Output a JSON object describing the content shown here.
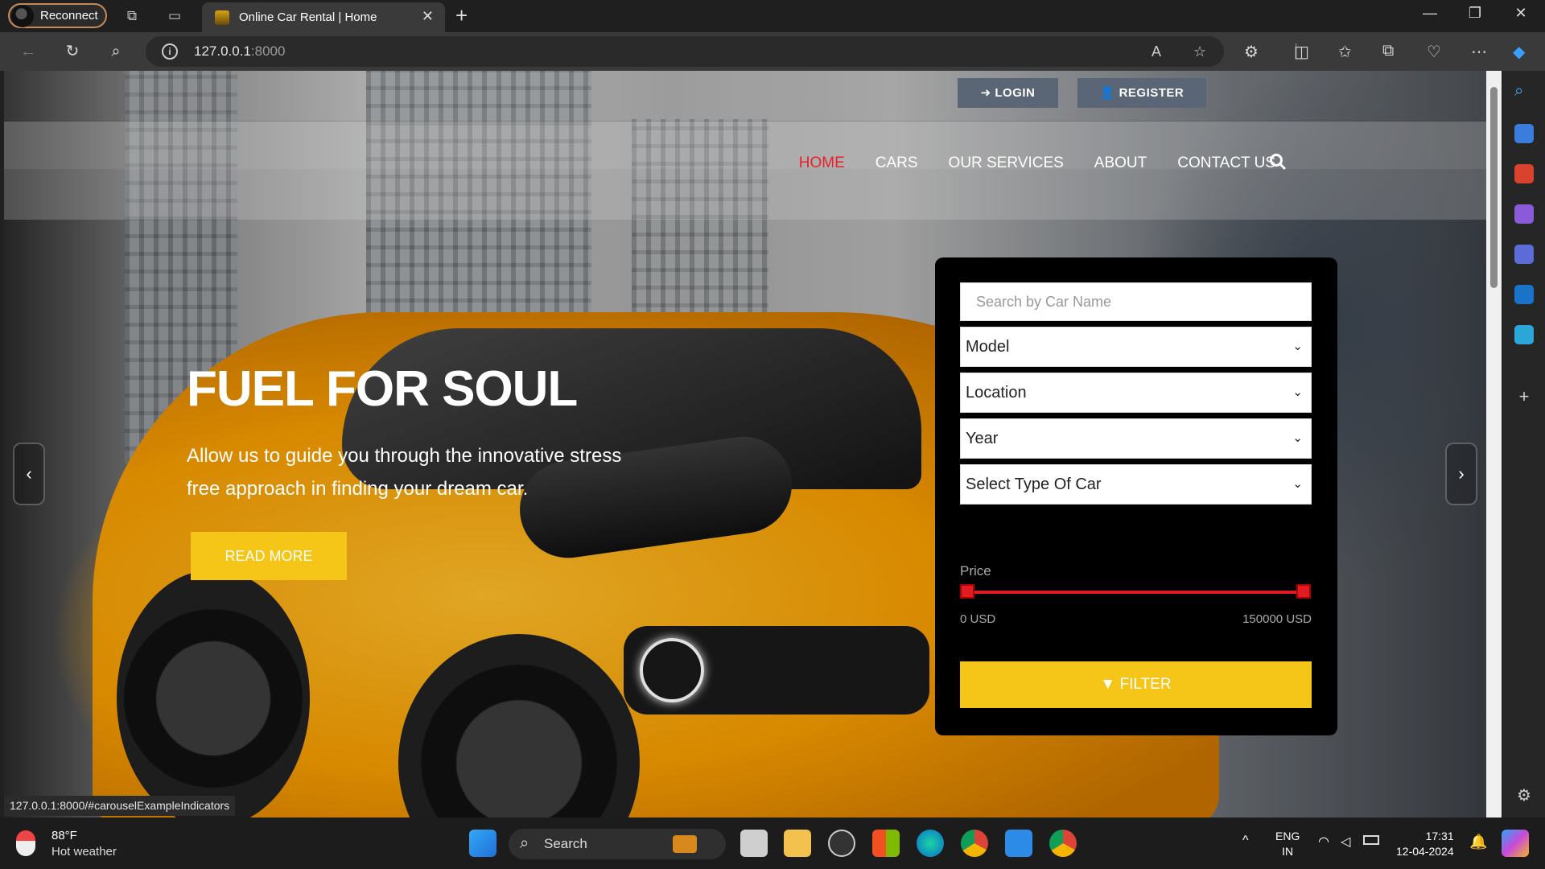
{
  "browser": {
    "reconnect_label": "Reconnect",
    "tab_title": "Online Car Rental | Home",
    "url_host": "127.0.0.1",
    "url_port": ":8000",
    "status_url": "127.0.0.1:8000/#carouselExampleIndicators"
  },
  "header": {
    "login_label": "LOGIN",
    "register_label": "REGISTER",
    "nav": [
      {
        "label": "HOME",
        "active": true
      },
      {
        "label": "CARS",
        "active": false
      },
      {
        "label": "OUR SERVICES",
        "active": false
      },
      {
        "label": "ABOUT",
        "active": false
      },
      {
        "label": "CONTACT US",
        "active": false
      }
    ]
  },
  "hero": {
    "title": "FUEL FOR SOUL",
    "subtitle": "Allow us to guide you through the innovative stress free approach in finding your dream car.",
    "cta_label": "READ MORE"
  },
  "filter": {
    "search_placeholder": "Search by Car Name",
    "model_selected": "Model",
    "location_selected": "Location",
    "year_selected": "Year",
    "type_selected": "Select Type Of Car",
    "price_label": "Price",
    "price_min": "0 USD",
    "price_max": "150000 USD",
    "button_label": "FILTER"
  },
  "taskbar": {
    "temperature": "88°F",
    "weather": "Hot weather",
    "search_label": "Search",
    "lang_line1": "ENG",
    "lang_line2": "IN",
    "time": "17:31",
    "date": "12-04-2024"
  },
  "colors": {
    "accent_yellow": "#f5c518",
    "nav_active_red": "#e8202a",
    "slider_red": "#e11b22"
  }
}
